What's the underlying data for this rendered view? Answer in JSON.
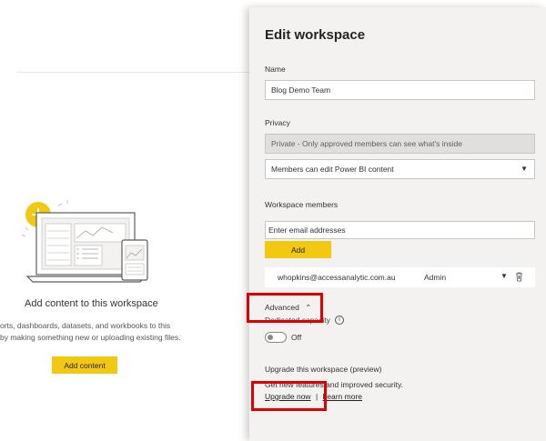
{
  "background": {
    "empty_state": {
      "title": "Add content to this workspace",
      "description_line1": "orts, dashboards, datasets, and workbooks to this",
      "description_line2": "by making something new or uploading existing files.",
      "add_content_label": "Add content"
    }
  },
  "panel": {
    "title": "Edit workspace",
    "name_label": "Name",
    "name_value": "Blog Demo Team",
    "privacy_label": "Privacy",
    "privacy_value": "Private - Only approved members can see what's inside",
    "permission_value": "Members can edit Power BI content",
    "members_label": "Workspace members",
    "email_placeholder": "Enter email addresses",
    "add_label": "Add",
    "members": [
      {
        "email": "whopkins@accessanalytic.com.au",
        "role": "Admin"
      }
    ],
    "advanced_label": "Advanced",
    "dedicated_capacity_label": "Dedicated capacity",
    "capacity_toggle_state": "Off",
    "upgrade_heading": "Upgrade this workspace (preview)",
    "upgrade_description": "Get new features and improved security.",
    "upgrade_link": "Upgrade now",
    "separator": "|",
    "learn_more_link": "Learn more"
  },
  "colors": {
    "accent_yellow": "#f2c811",
    "panel_bg": "#f3f2f1",
    "highlight_red": "#e00000"
  }
}
